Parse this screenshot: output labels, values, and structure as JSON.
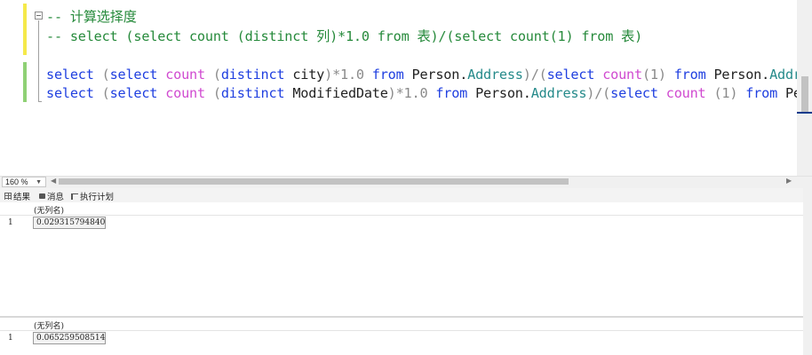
{
  "editor": {
    "lines": {
      "l1": {
        "comment": "-- 计算选择度"
      },
      "l2": {
        "comment": "-- select (select count (distinct 列)*1.0 from 表)/(select count(1) from 表)"
      },
      "l4": {
        "t1": "select",
        "t2": "(",
        "t3": "select",
        "t4": "count",
        "t5": "(",
        "t6": "distinct",
        "t7": "city",
        "t8": ")*1.0",
        "t9": "from",
        "t10": "Person.",
        "t11": "Address",
        "t12": ")/(",
        "t13": "select",
        "t14": "count",
        "t15": "(1)",
        "t16": "from",
        "t17": "Person.",
        "t18": "Addres"
      },
      "l5": {
        "t1": "select",
        "t2": "(",
        "t3": "select",
        "t4": "count",
        "t5": "(",
        "t6": "distinct",
        "t7": "ModifiedDate",
        "t8": ")*1.0",
        "t9": "from",
        "t10": "Person.",
        "t11": "Address",
        "t12": ")/(",
        "t13": "select",
        "t14": "count",
        "t15": "(1)",
        "t16": "from",
        "t17": "Perso"
      }
    }
  },
  "zoom": {
    "level": "160 %"
  },
  "tabs": {
    "results": "结果",
    "messages": "消息",
    "plan": "执行计划"
  },
  "results": [
    {
      "column": "(无列名)",
      "row": "1",
      "value": "0.029315794840"
    },
    {
      "column": "(无列名)",
      "row": "1",
      "value": "0.065259508514"
    }
  ]
}
